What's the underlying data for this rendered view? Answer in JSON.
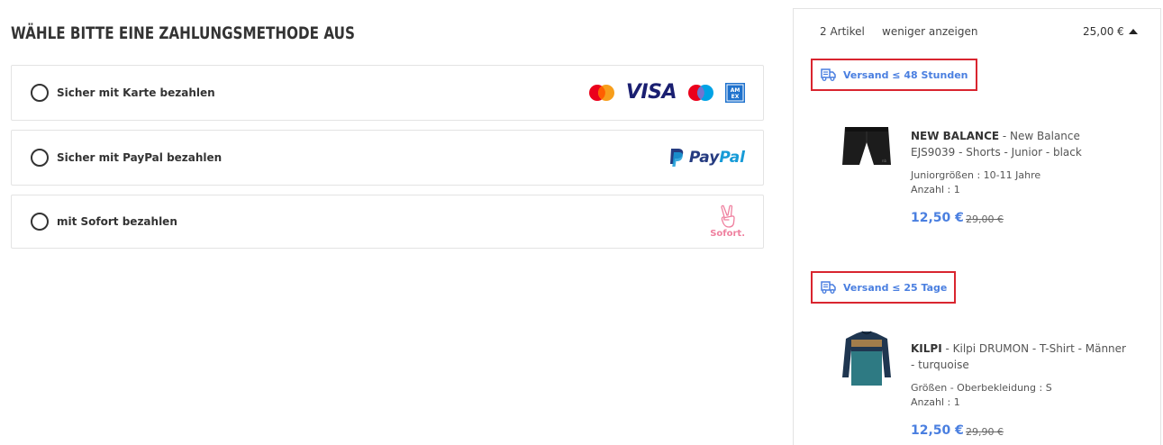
{
  "payment": {
    "title": "WÄHLE BITTE EINE ZAHLUNGSMETHODE AUS",
    "options": [
      {
        "label": "Sicher mit Karte bezahlen",
        "logos": [
          "mastercard-logo",
          "visa-logo",
          "maestro-logo",
          "amex-logo"
        ],
        "visa_text": "VISA",
        "amex_text": "AM EX"
      },
      {
        "label": "Sicher mit PayPal bezahlen",
        "logos": [
          "paypal-logo"
        ],
        "paypal_text_1": "Pay",
        "paypal_text_2": "Pal"
      },
      {
        "label": "mit Sofort bezahlen",
        "logos": [
          "sofort-logo"
        ],
        "sofort_text": "Sofort."
      }
    ]
  },
  "cart": {
    "count": "2 Artikel",
    "toggle_label": "weniger anzeigen",
    "total": "25,00 €",
    "groups": [
      {
        "shipping": "Versand ≤ 48 Stunden",
        "product": {
          "brand": "NEW BALANCE",
          "name": " - New Balance EJS9039 - Shorts - Junior - black",
          "size": "Juniorgrößen : 10-11 Jahre",
          "qty": "Anzahl : 1",
          "price": "12,50 €",
          "old_price": "29,00 €",
          "image": "shorts-image"
        }
      },
      {
        "shipping": "Versand ≤ 25 Tage",
        "product": {
          "brand": "KILPI",
          "name": " - Kilpi DRUMON - T-Shirt - Männer - turquoise",
          "size": "Größen - Oberbekleidung : S",
          "qty": "Anzahl : 1",
          "price": "12,50 €",
          "old_price": "29,90 €",
          "image": "longsleeve-image"
        }
      }
    ]
  },
  "colors": {
    "accent_blue": "#4a7fe0",
    "badge_border_red": "#d9252f",
    "visa_navy": "#1a1f71",
    "sofort_pink": "#ef809f"
  }
}
